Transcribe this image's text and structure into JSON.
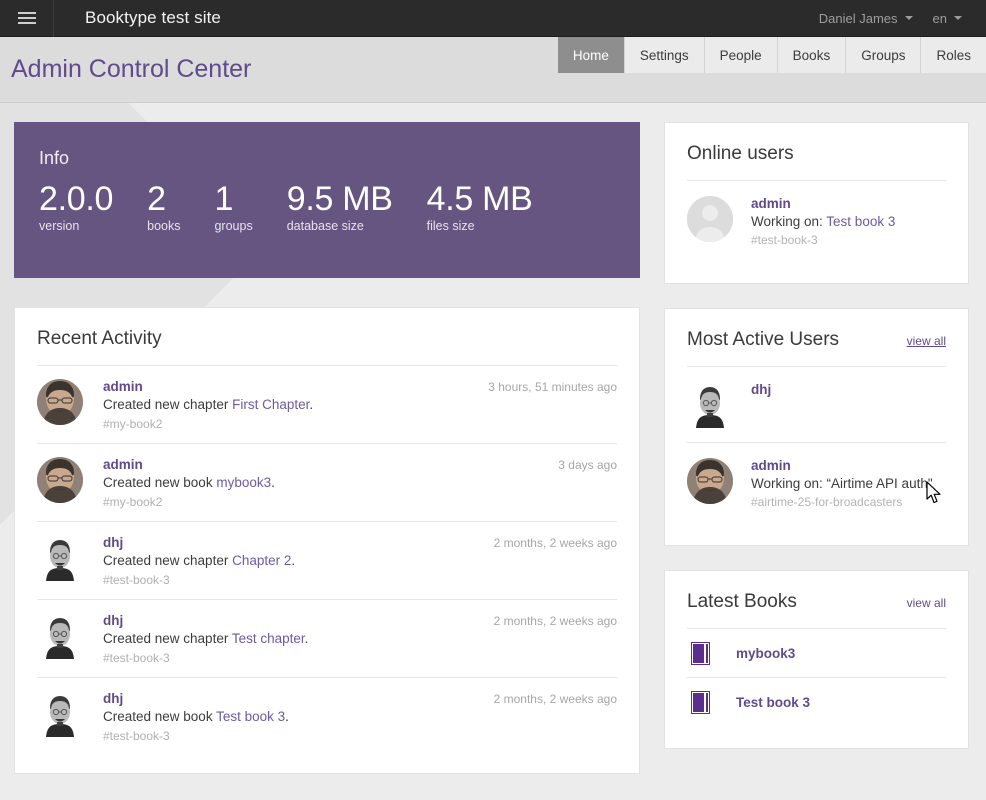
{
  "topbar": {
    "menu_icon": "hamburger-icon",
    "site_title": "Booktype test site",
    "user_name": "Daniel James",
    "language": "en"
  },
  "header": {
    "page_title": "Admin Control Center",
    "tabs": [
      {
        "label": "Home",
        "active": true
      },
      {
        "label": "Settings",
        "active": false
      },
      {
        "label": "People",
        "active": false
      },
      {
        "label": "Books",
        "active": false
      },
      {
        "label": "Groups",
        "active": false
      },
      {
        "label": "Roles",
        "active": false
      }
    ]
  },
  "info_panel": {
    "title": "Info",
    "accent_color": "#665580",
    "stats": [
      {
        "value": "2.0.0",
        "label": "version"
      },
      {
        "value": "2",
        "label": "books"
      },
      {
        "value": "1",
        "label": "groups"
      },
      {
        "value": "9.5 MB",
        "label": "database size"
      },
      {
        "value": "4.5 MB",
        "label": "files size"
      }
    ]
  },
  "recent_activity": {
    "title": "Recent Activity",
    "items": [
      {
        "user": "admin",
        "avatar": "admin-photo",
        "text_before": "Created new chapter ",
        "link": "First Chapter",
        "text_after": ".",
        "tag": "#my-book2",
        "time": "3 hours, 51 minutes ago"
      },
      {
        "user": "admin",
        "avatar": "admin-photo",
        "text_before": "Created new book ",
        "link": "mybook3",
        "text_after": ".",
        "tag": "#my-book2",
        "time": "3 days ago"
      },
      {
        "user": "dhj",
        "avatar": "dhj-photo",
        "text_before": "Created new chapter ",
        "link": "Chapter 2",
        "text_after": ".",
        "tag": "#test-book-3",
        "time": "2 months, 2 weeks ago"
      },
      {
        "user": "dhj",
        "avatar": "dhj-photo",
        "text_before": "Created new chapter ",
        "link": "Test chapter",
        "text_after": ".",
        "tag": "#test-book-3",
        "time": "2 months, 2 weeks ago"
      },
      {
        "user": "dhj",
        "avatar": "dhj-photo",
        "text_before": "Created new book ",
        "link": "Test book 3",
        "text_after": ".",
        "tag": "#test-book-3",
        "time": "2 months, 2 weeks ago"
      }
    ]
  },
  "online_users": {
    "title": "Online users",
    "items": [
      {
        "user": "admin",
        "avatar": "default-avatar",
        "working_prefix": "Working on: ",
        "working_link": "Test book 3",
        "tag": "#test-book-3"
      }
    ]
  },
  "most_active_users": {
    "title": "Most Active Users",
    "view_all_label": "view all",
    "items": [
      {
        "user": "dhj",
        "avatar": "dhj-photo",
        "working_prefix": "",
        "working_link": "",
        "tag": ""
      },
      {
        "user": "admin",
        "avatar": "admin-photo",
        "working_prefix": "Working on: ",
        "working_link": "“Airtime API auth\"",
        "tag": "#airtime-25-for-broadcasters"
      }
    ]
  },
  "latest_books": {
    "title": "Latest Books",
    "view_all_label": "view all",
    "items": [
      {
        "name": "mybook3",
        "icon": "book-icon"
      },
      {
        "name": "Test book 3",
        "icon": "book-icon"
      }
    ]
  }
}
